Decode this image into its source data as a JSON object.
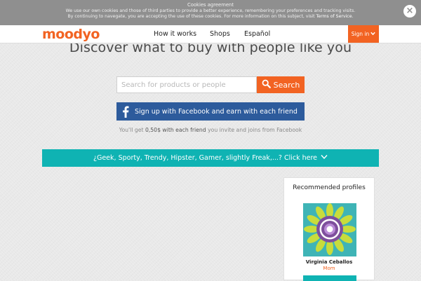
{
  "cookie": {
    "title": "Cookies agreement",
    "line1": "We use our own cookies and those of third parties to provide a better experience, remembering your preferences and tracking visits.",
    "line2": "By continuing to navegate, you are accepting the use of these cookies. For more information on this subject, visit",
    "link": "Terms of Service",
    "link_suffix": ".",
    "close_symbol": "×"
  },
  "nav": {
    "logo": "moodyo",
    "links": [
      "How it works",
      "Shops",
      "Español"
    ],
    "signin": "Sign in",
    "brand_color": "#f26322"
  },
  "hero": {
    "headline": "Discover what to buy with people like you",
    "search_placeholder": "Search for products or people",
    "search_button": "Search",
    "facebook_button": "Sign up with Facebook and earn with each friend",
    "reward_prefix": "You'll get",
    "reward_bold": "0,50$ with each friend",
    "reward_suffix": "you invite and joins from Facebook"
  },
  "banner": {
    "text": "¿Geek, Sporty, Trendy, Hipster, Gamer, slightly Freak,...? Click here",
    "color": "#0fb3b3"
  },
  "recommended": {
    "title": "Recommended profiles",
    "profiles": [
      {
        "name": "Virginia Ceballos",
        "role": "Mom",
        "icon": "flower-avatar-icon"
      }
    ]
  },
  "icons": {
    "search": "search-icon",
    "facebook": "facebook-icon",
    "close": "close-icon",
    "chevron": "chevron-down-icon"
  }
}
